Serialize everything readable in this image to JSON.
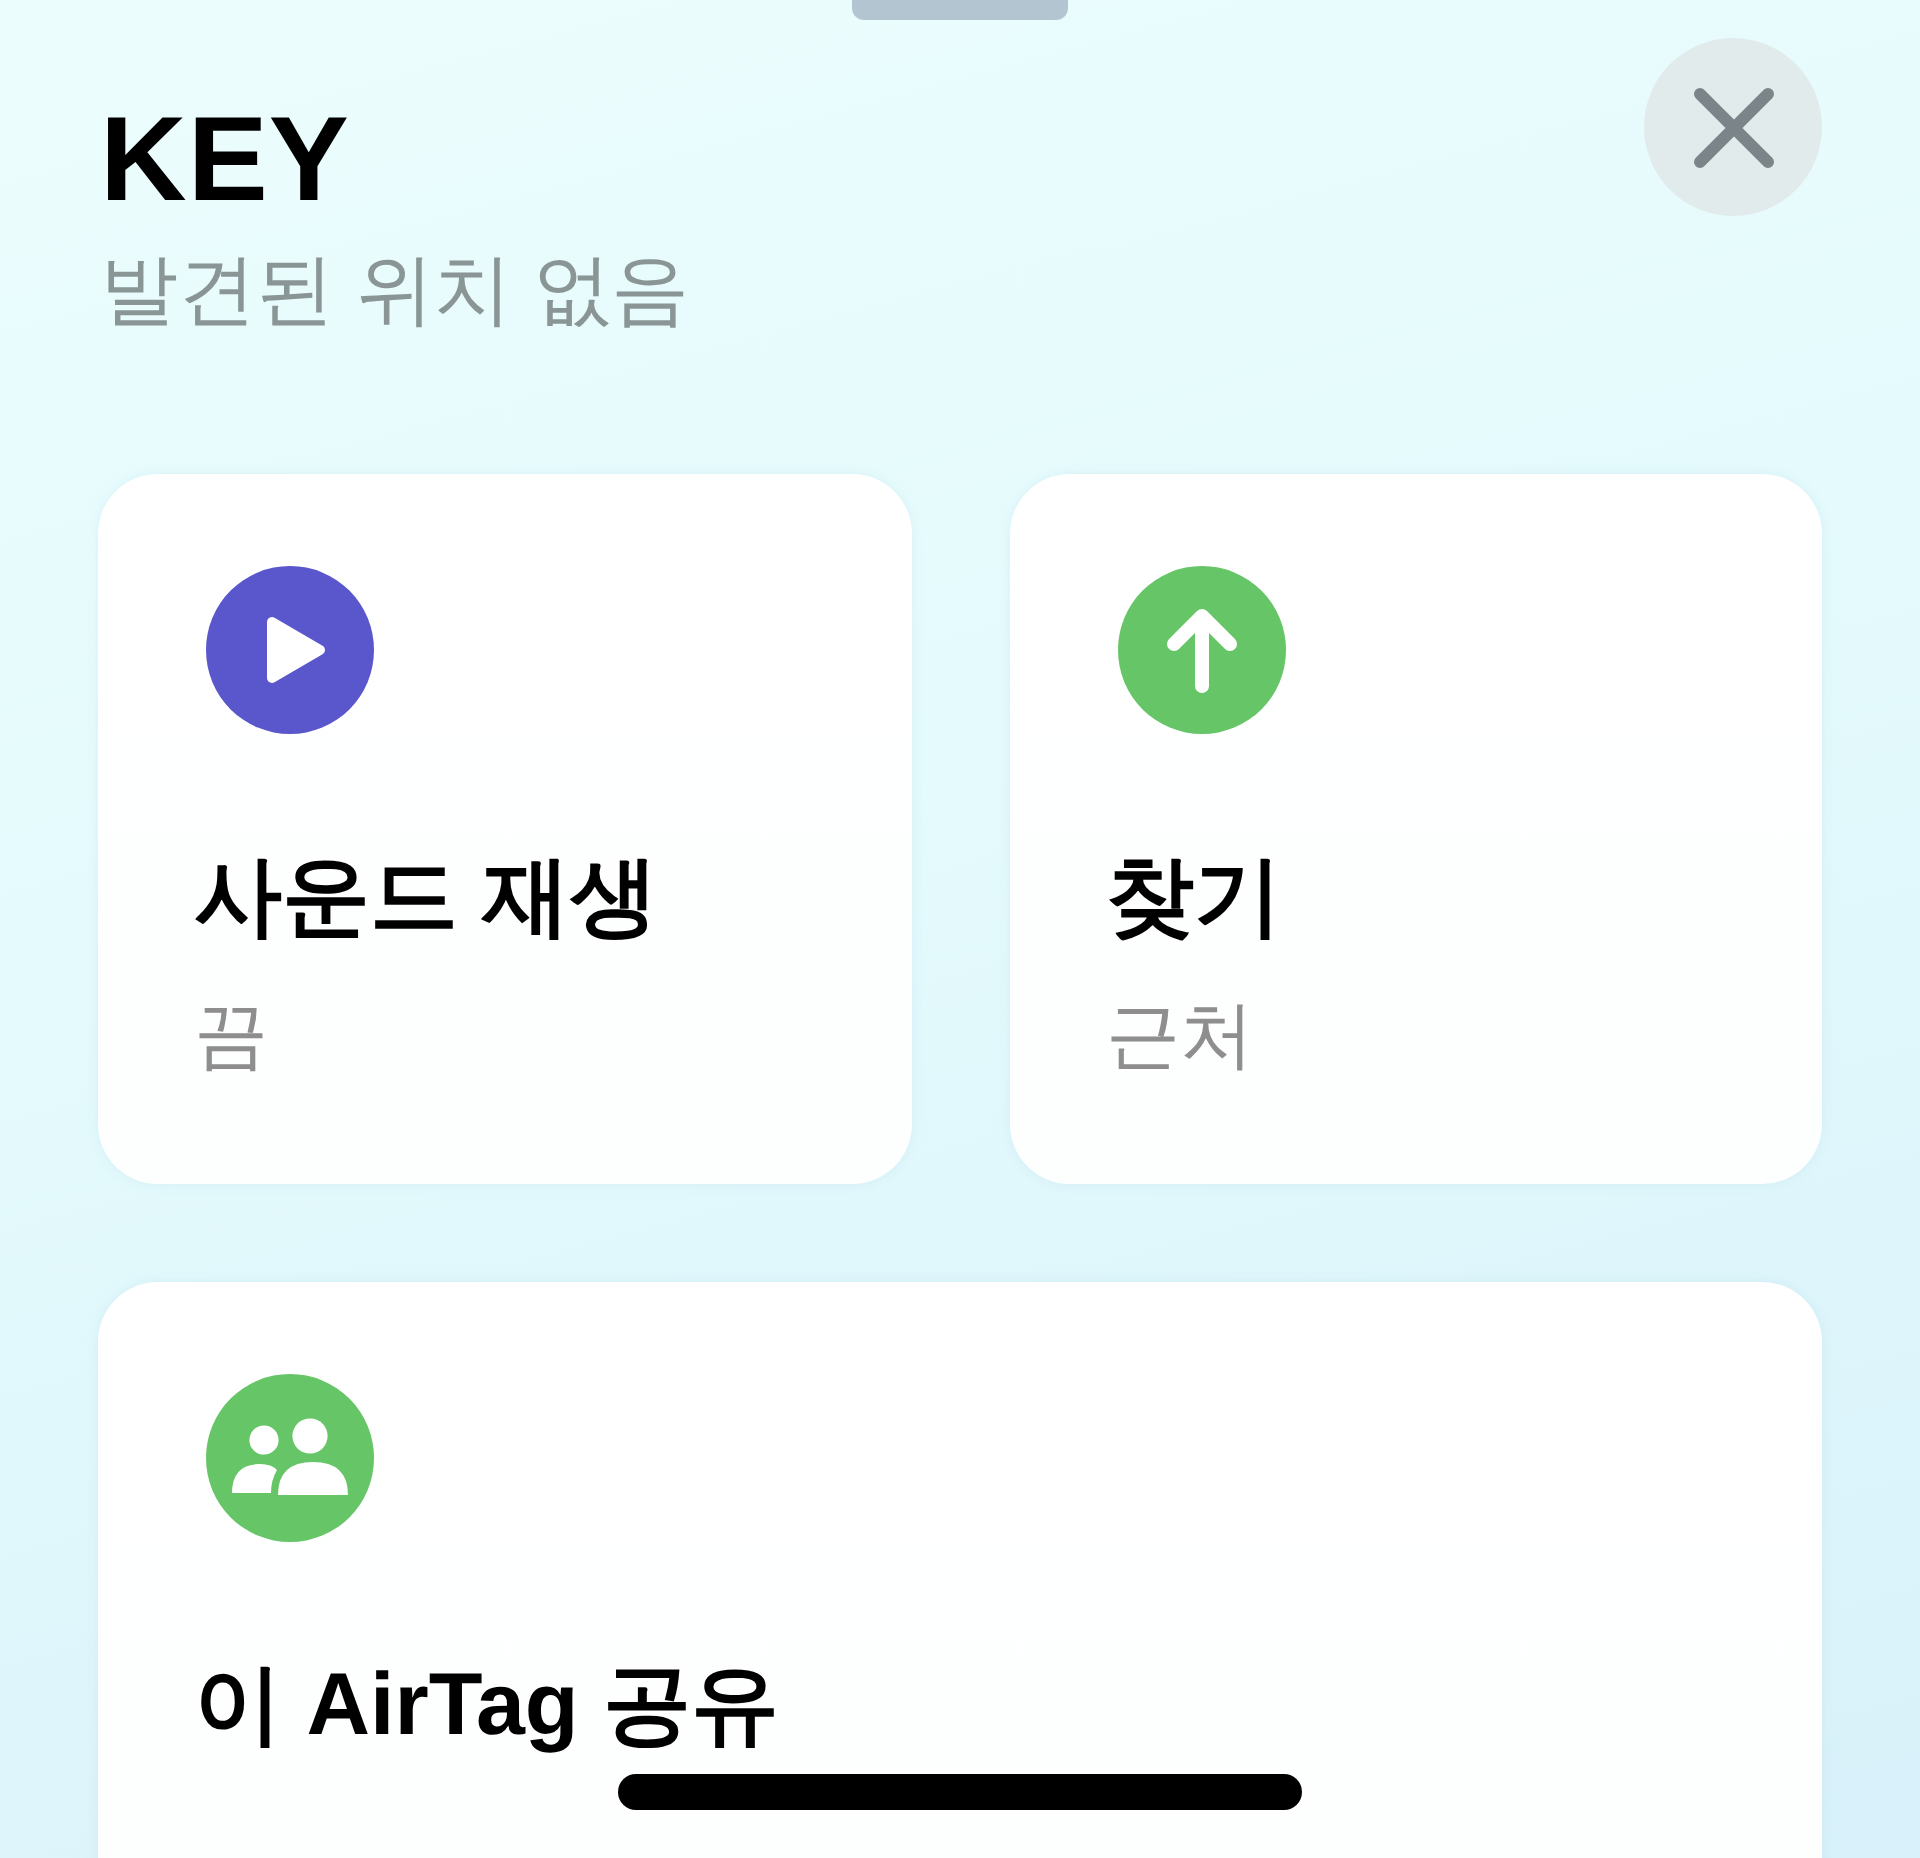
{
  "sheet": {
    "title": "KEY",
    "subtitle": "발견된 위치 없음"
  },
  "actions": [
    {
      "kind": "sound",
      "title": "사운드 재생",
      "status": "끔",
      "color": "#5a57cc"
    },
    {
      "kind": "find",
      "title": "찾기",
      "status": "근처",
      "color": "#66c566"
    },
    {
      "kind": "share",
      "title": "이 AirTag 공유",
      "color": "#66c566"
    }
  ]
}
